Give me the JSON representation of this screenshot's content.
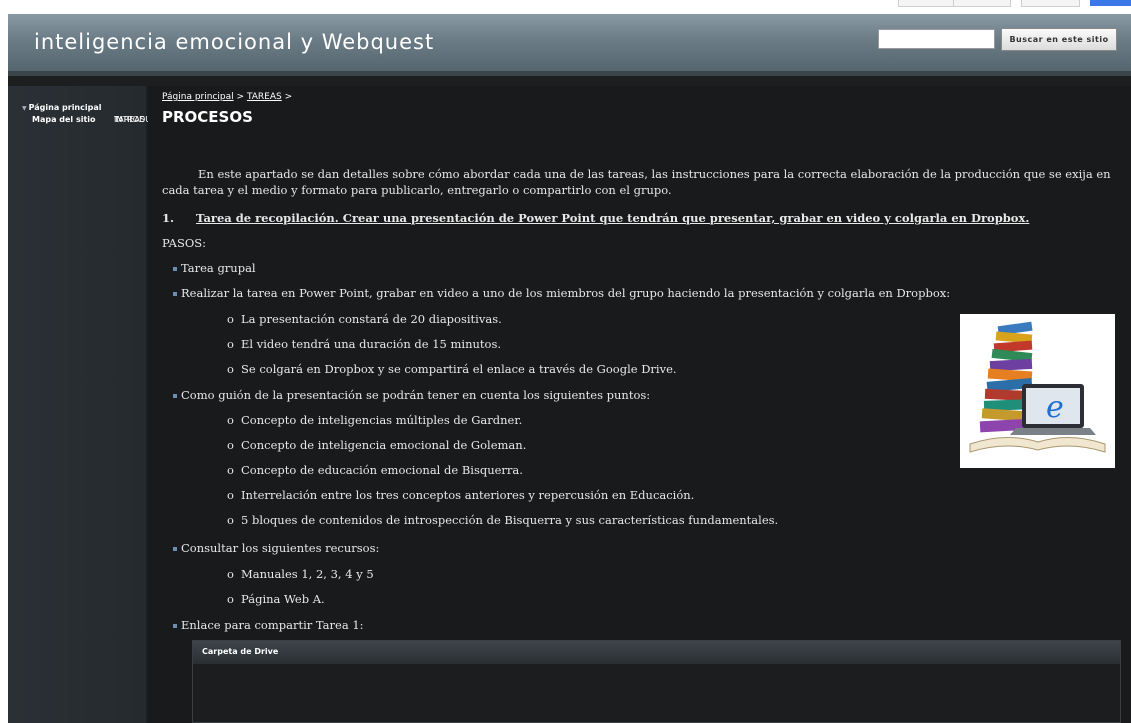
{
  "header": {
    "site_title": "inteligencia emocional y Webquest",
    "search_placeholder": "",
    "search_button": "Buscar en este sitio"
  },
  "sidebar": {
    "items": [
      {
        "label": "Página principal"
      },
      {
        "label": "INTRODUCCIÓN"
      },
      {
        "label": "TAREAS"
      },
      {
        "label": "Mapa del sitio"
      }
    ]
  },
  "breadcrumb": {
    "home": "Página principal",
    "sep1": ">",
    "tareas": "TAREAS",
    "sep2": ">"
  },
  "page": {
    "title": "PROCESOS",
    "intro": "En este apartado se dan detalles sobre cómo abordar cada una de las tareas, las instrucciones para la correcta elaboración de la producción que se exija en cada tarea y el medio y formato  para publicarlo, entregarlo o compartirlo con el grupo.",
    "task_number": "1.",
    "task_heading": "Tarea de recopilación. Crear una presentación de Power Point que tendrán que presentar, grabar en video y colgarla en Dropbox.",
    "pasos_label": "PASOS:",
    "bullets": [
      "Tarea grupal",
      "Realizar la tarea en Power Point, grabar en video a uno de los miembros del grupo haciendo la presentación y colgarla en Dropbox:",
      "Como guión de la presentación se podrán tener en cuenta los siguientes puntos:",
      "Consultar los siguientes recursos:",
      "Enlace para compartir Tarea 1:"
    ],
    "sub_a": [
      "La presentación constará de 20 diapositivas.",
      "El video tendrá una duración de 15 minutos.",
      "Se colgará en Dropbox y se compartirá el enlace a través de Google Drive."
    ],
    "sub_b": [
      "Concepto de inteligencias múltiples de Gardner.",
      "Concepto de inteligencia emocional de Goleman.",
      "Concepto de educación emocional de Bisquerra.",
      "Interrelación entre los tres conceptos anteriores y repercusión en Educación.",
      "5 bloques de contenidos de introspección de Bisquerra y sus características fundamentales."
    ],
    "sub_c": [
      "Manuales 1, 2, 3, 4 y 5",
      "Página Web A."
    ],
    "sub_marker": "o",
    "image_letter": "e",
    "drive_title": "Carpeta de Drive"
  },
  "colors": {
    "header": "#6b7c86",
    "background": "#181a1b",
    "sidebar": "#252a2e",
    "text": "#e8e8e8",
    "accent_blue": "#3b78e7"
  }
}
